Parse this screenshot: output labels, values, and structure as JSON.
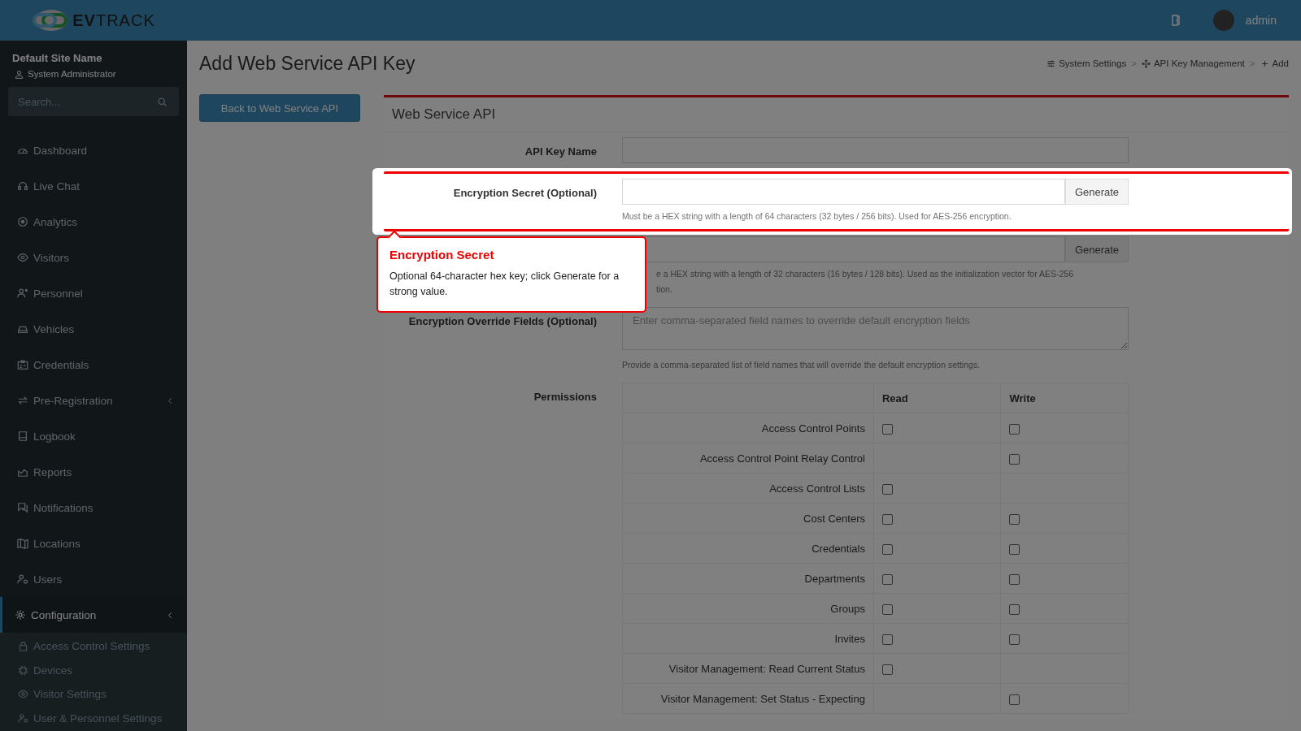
{
  "header": {
    "logo": {
      "bold": "EV",
      "light": "TRACK"
    },
    "user": "admin"
  },
  "sidebar": {
    "site_name": "Default Site Name",
    "role": "System Administrator",
    "search": {
      "placeholder": "Search..."
    },
    "items": [
      {
        "label": "Dashboard",
        "selected": false,
        "has_submenu": false
      },
      {
        "label": "Live Chat",
        "selected": false,
        "has_submenu": false
      },
      {
        "label": "Analytics",
        "selected": false,
        "has_submenu": false
      },
      {
        "label": "Visitors",
        "selected": false,
        "has_submenu": false
      },
      {
        "label": "Personnel",
        "selected": false,
        "has_submenu": false
      },
      {
        "label": "Vehicles",
        "selected": false,
        "has_submenu": false
      },
      {
        "label": "Credentials",
        "selected": false,
        "has_submenu": false
      },
      {
        "label": "Pre-Registration",
        "selected": false,
        "has_submenu": true
      },
      {
        "label": "Logbook",
        "selected": false,
        "has_submenu": false
      },
      {
        "label": "Reports",
        "selected": false,
        "has_submenu": false
      },
      {
        "label": "Notifications",
        "selected": false,
        "has_submenu": false
      },
      {
        "label": "Locations",
        "selected": false,
        "has_submenu": false
      },
      {
        "label": "Users",
        "selected": false,
        "has_submenu": false
      },
      {
        "label": "Configuration",
        "selected": true,
        "has_submenu": true,
        "children": [
          {
            "label": "Access Control Settings"
          },
          {
            "label": "Devices"
          },
          {
            "label": "Visitor Settings"
          },
          {
            "label": "User & Personnel Settings"
          }
        ]
      }
    ]
  },
  "page": {
    "title": "Add Web Service API Key",
    "breadcrumb": [
      "System Settings",
      "API Key Management",
      "Add"
    ],
    "breadcrumb_separator": ">",
    "back_button": "Back to Web Service API"
  },
  "card": {
    "title": "Web Service API",
    "fields": [
      {
        "kind": "input",
        "label": "API Key Name",
        "highlighted": false
      },
      {
        "kind": "generate",
        "label": "Encryption Secret (Optional)",
        "button": "Generate",
        "help": [
          "Must be a HEX string with a length of 64 characters (32 bytes / 256 bits). Used for AES-256 encryption."
        ],
        "highlighted": true
      },
      {
        "kind": "generate",
        "button": "Generate",
        "help": [
          "e a HEX string with a length of 32 characters (16 bytes / 128 bits). Used as the initialization vector for AES-256",
          "tion."
        ],
        "highlighted": false
      },
      {
        "kind": "textarea",
        "label": "Encryption Override Fields (Optional)",
        "placeholder": "Enter comma-separated field names to override default encryption fields",
        "help": [
          "Provide a comma-separated list of field names that will override the default encryption settings."
        ],
        "highlighted": false
      }
    ],
    "permissions": {
      "label": "Permissions",
      "columns": [
        "Read",
        "Write"
      ],
      "rows": [
        {
          "name": "Access Control Points",
          "read": false,
          "write": false
        },
        {
          "name": "Access Control Point Relay Control",
          "write": false
        },
        {
          "name": "Access Control Lists",
          "read": false
        },
        {
          "name": "Cost Centers",
          "read": false,
          "write": false
        },
        {
          "name": "Credentials",
          "read": false,
          "write": false
        },
        {
          "name": "Departments",
          "read": false,
          "write": false
        },
        {
          "name": "Groups",
          "read": false,
          "write": false
        },
        {
          "name": "Invites",
          "read": false,
          "write": false
        },
        {
          "name": "Visitor Management: Read Current Status",
          "read": false
        },
        {
          "name": "Visitor Management: Set Status - Expecting",
          "write": false
        }
      ]
    }
  },
  "tour": {
    "title": "Encryption Secret",
    "text": "Optional 64-character hex key; click Generate for a strong value."
  }
}
